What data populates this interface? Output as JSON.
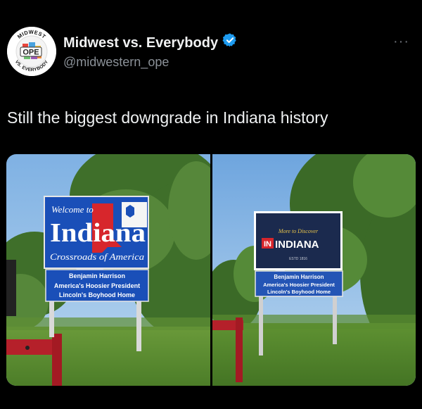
{
  "account": {
    "display_name": "Midwest vs. Everybody",
    "handle": "@midwestern_ope",
    "verified": true,
    "avatar_text_top": "MIDWEST",
    "avatar_text_center": "OPE",
    "avatar_text_bottom": "VS. EVERYBODY"
  },
  "tweet": {
    "text": "Still the biggest downgrade in Indiana history"
  },
  "icons": {
    "more": "more-icon",
    "verified": "verified-badge-icon"
  },
  "media": {
    "left_photo": {
      "sign_top": "Welcome to",
      "sign_state": "Indiana",
      "sign_sub": "Crossroads of America",
      "plaque": [
        "Benjamin Harrison",
        "America's Hoosier President",
        "Lincoln's Boyhood Home"
      ]
    },
    "right_photo": {
      "sign_top": "More to Discover",
      "sign_badge": "IN",
      "sign_state": "INDIANA",
      "sign_est": "ESTD 1816",
      "plaque": [
        "Benjamin Harrison",
        "America's Hoosier President",
        "Lincoln's Boyhood Home"
      ]
    }
  },
  "colors": {
    "background": "#000000",
    "verified": "#1d9bf0",
    "old_sign_blue": "#1a4fb8",
    "old_sign_red": "#d7262c",
    "new_sign_navy": "#1b2a4e"
  }
}
